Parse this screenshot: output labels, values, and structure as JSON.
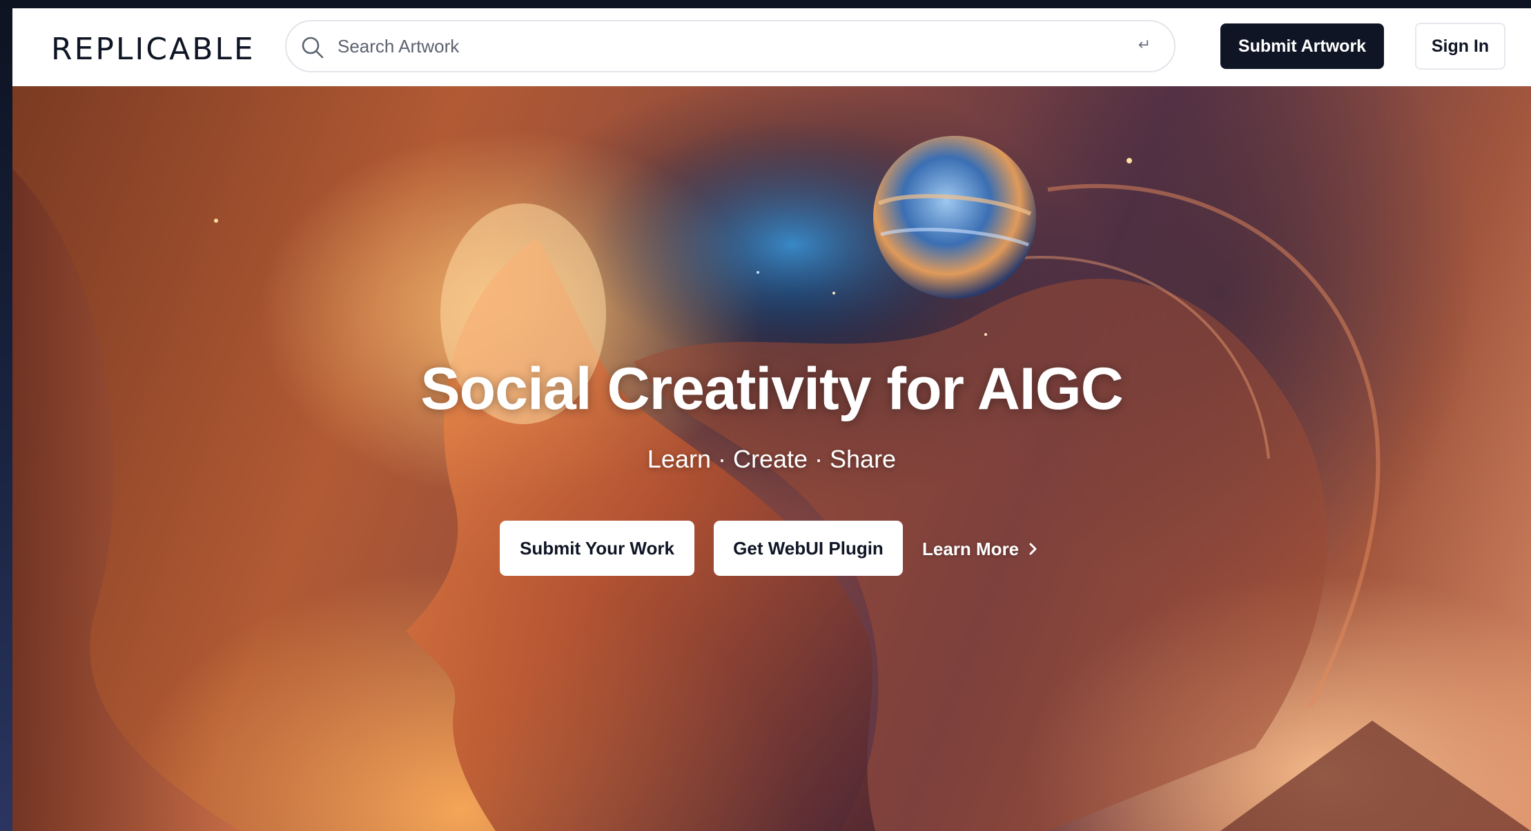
{
  "header": {
    "logo": "REPLICABLE",
    "search": {
      "placeholder": "Search Artwork",
      "enter_glyph": "↵"
    },
    "submit_artwork_label": "Submit Artwork",
    "sign_in_label": "Sign In"
  },
  "hero": {
    "title": "Social Creativity for AIGC",
    "subtitle": "Learn · Create · Share",
    "buttons": [
      {
        "label": "Submit Your Work"
      },
      {
        "label": "Get WebUI Plugin"
      }
    ],
    "learn_more_label": "Learn More"
  },
  "icons": [
    "search-icon",
    "enter-icon",
    "chevron-right-icon"
  ],
  "colors": {
    "primary": "#0f1525",
    "background": "#ffffff",
    "hero_text": "#ffffff"
  }
}
